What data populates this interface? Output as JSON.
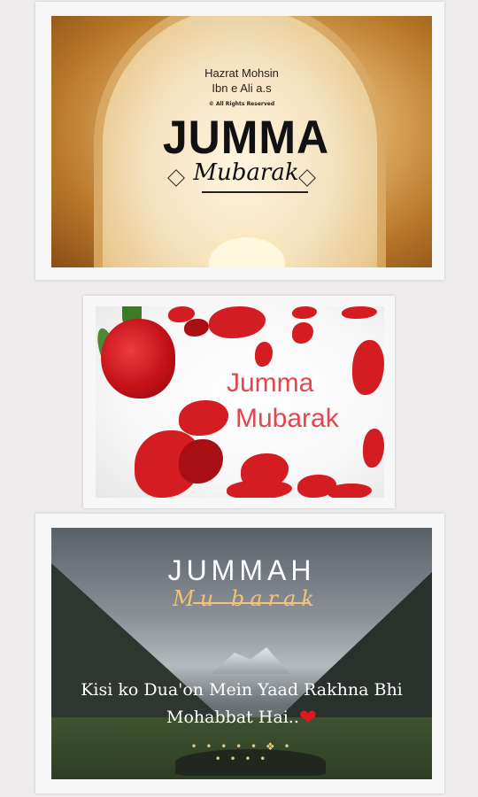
{
  "cards": [
    {
      "author_line1": "Hazrat Mohsin",
      "author_line2": "Ibn e Ali a.s",
      "rights": "© All Rights Reserved",
      "title": "JUMMA",
      "subtitle": "Mubarak"
    },
    {
      "title_line1": "Jumma",
      "title_line2": "Mubarak"
    },
    {
      "title": "JUMMAH",
      "subtitle": "Mu barak",
      "quote_line1": "Kisi ko Dua'on Mein Yaad Rakhna Bhi",
      "quote_line2": "Mohabbat Hai..",
      "heart": "❤",
      "ornament": "• • • • • ❖ • • • • •"
    }
  ],
  "colors": {
    "card2_text": "#e0474f",
    "card3_subtitle": "#f0c27a",
    "heart": "#e3161f"
  }
}
